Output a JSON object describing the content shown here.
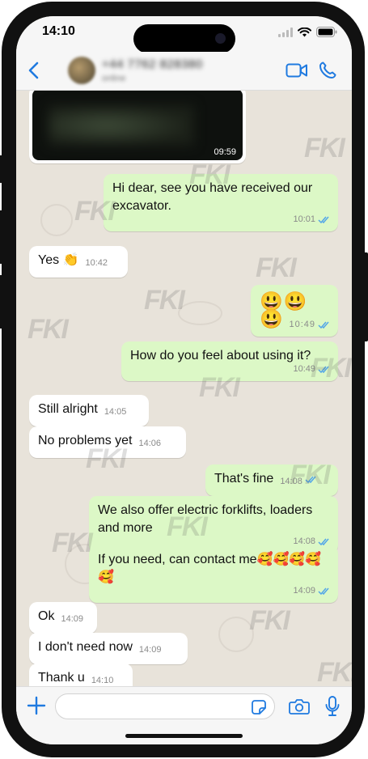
{
  "status": {
    "time": "14:10"
  },
  "header": {
    "contact_name": "+44 7762 828380",
    "contact_sub": "online"
  },
  "colors": {
    "accent": "#1f7ae0",
    "outgoing": "#dcf8c6",
    "incoming": "#ffffff",
    "read_ticks": "#53a6e8"
  },
  "media": {
    "time": "09:59"
  },
  "messages": [
    {
      "text": "Hi dear, see you have received our excavator.",
      "time": "10:01",
      "dir": "out"
    },
    {
      "text": "Yes 👏",
      "time": "10:42",
      "dir": "in"
    },
    {
      "text": "😃😃😃",
      "time": "10:49",
      "dir": "out"
    },
    {
      "text": "How do you feel about using it?",
      "time": "10:49",
      "dir": "out"
    },
    {
      "text": "Still alright",
      "time": "14:05",
      "dir": "in"
    },
    {
      "text": "No problems yet",
      "time": "14:06",
      "dir": "in"
    },
    {
      "text": "That's fine",
      "time": "14:08",
      "dir": "out"
    },
    {
      "text": "We also offer electric forklifts, loaders and more",
      "time": "14:08",
      "dir": "out"
    },
    {
      "text": "If you need, can contact me🥰🥰🥰🥰🥰",
      "time": "14:09",
      "dir": "out"
    },
    {
      "text": "Ok",
      "time": "14:09",
      "dir": "in"
    },
    {
      "text": "I don't need now",
      "time": "14:09",
      "dir": "in"
    },
    {
      "text": "Thank u",
      "time": "14:10",
      "dir": "in"
    }
  ],
  "input": {
    "value": "",
    "placeholder": ""
  },
  "icons": {
    "back": "chevron-left-icon",
    "video": "video-camera-icon",
    "call": "phone-icon",
    "plus": "plus-icon",
    "sticker": "sticker-icon",
    "camera": "camera-icon",
    "mic": "microphone-icon"
  },
  "watermark": {
    "text": "FKI"
  }
}
